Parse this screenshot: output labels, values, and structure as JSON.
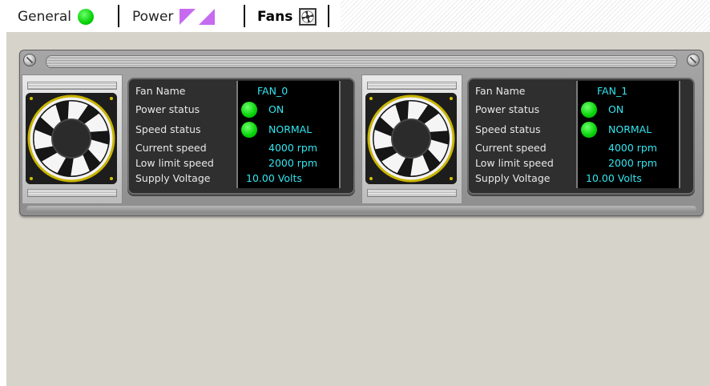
{
  "tabs": [
    {
      "label": "General",
      "icon": "green-status-icon"
    },
    {
      "label": "Power",
      "icon": "power-triangles-icon"
    },
    {
      "label": "Fans",
      "icon": "fan-icon",
      "active": true
    }
  ],
  "colors": {
    "status_ok": "#06d206",
    "value_text": "#32e6f0",
    "power_accent": "#c66bf0"
  },
  "fans": [
    {
      "rows": [
        {
          "label": "Fan Name",
          "value": "FAN_0"
        },
        {
          "label": "Power status",
          "value": "ON",
          "status": "ok"
        },
        {
          "label": "Speed status",
          "value": "NORMAL",
          "status": "ok"
        },
        {
          "label": "Current speed",
          "value": "4000 rpm"
        },
        {
          "label": "Low limit speed",
          "value": "2000 rpm"
        },
        {
          "label": "Supply Voltage",
          "value": "10.00 Volts"
        }
      ]
    },
    {
      "rows": [
        {
          "label": "Fan Name",
          "value": "FAN_1"
        },
        {
          "label": "Power status",
          "value": "ON",
          "status": "ok"
        },
        {
          "label": "Speed status",
          "value": "NORMAL",
          "status": "ok"
        },
        {
          "label": "Current speed",
          "value": "4000 rpm"
        },
        {
          "label": "Low limit speed",
          "value": "2000 rpm"
        },
        {
          "label": "Supply Voltage",
          "value": "10.00 Volts"
        }
      ]
    }
  ]
}
